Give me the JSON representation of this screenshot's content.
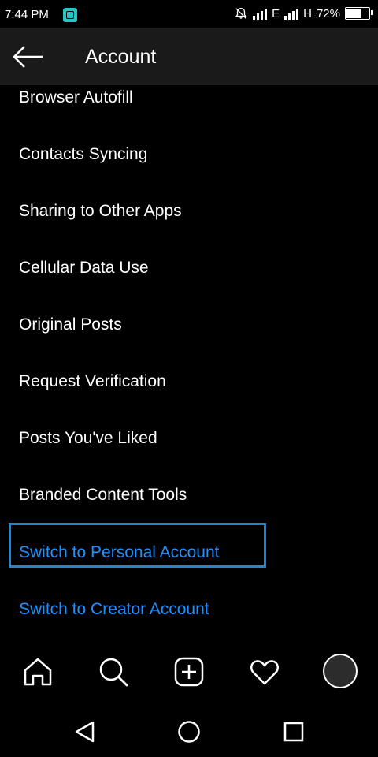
{
  "status_bar": {
    "time": "7:44 PM",
    "network_1": "E",
    "network_2": "H",
    "battery": "72%",
    "battery_level": 0.72
  },
  "header": {
    "title": "Account",
    "back_icon": "arrow-left-icon"
  },
  "menu": {
    "items": [
      {
        "label": "Browser Autofill"
      },
      {
        "label": "Contacts Syncing"
      },
      {
        "label": "Sharing to Other Apps"
      },
      {
        "label": "Cellular Data Use"
      },
      {
        "label": "Original Posts"
      },
      {
        "label": "Request Verification"
      },
      {
        "label": "Posts You've Liked"
      },
      {
        "label": "Branded Content Tools"
      },
      {
        "label": "Switch to Personal Account"
      },
      {
        "label": "Switch to Creator Account"
      }
    ]
  },
  "colors": {
    "background": "#000000",
    "header": "#1a1a1a",
    "link": "#1e90ff",
    "highlight": "#1c87d8"
  },
  "bottom_nav": {
    "icons": [
      "home-icon",
      "search-icon",
      "add-post-icon",
      "heart-icon",
      "profile-avatar"
    ]
  },
  "system_nav": {
    "icons": [
      "back-triangle-icon",
      "home-circle-icon",
      "recents-square-icon"
    ]
  }
}
